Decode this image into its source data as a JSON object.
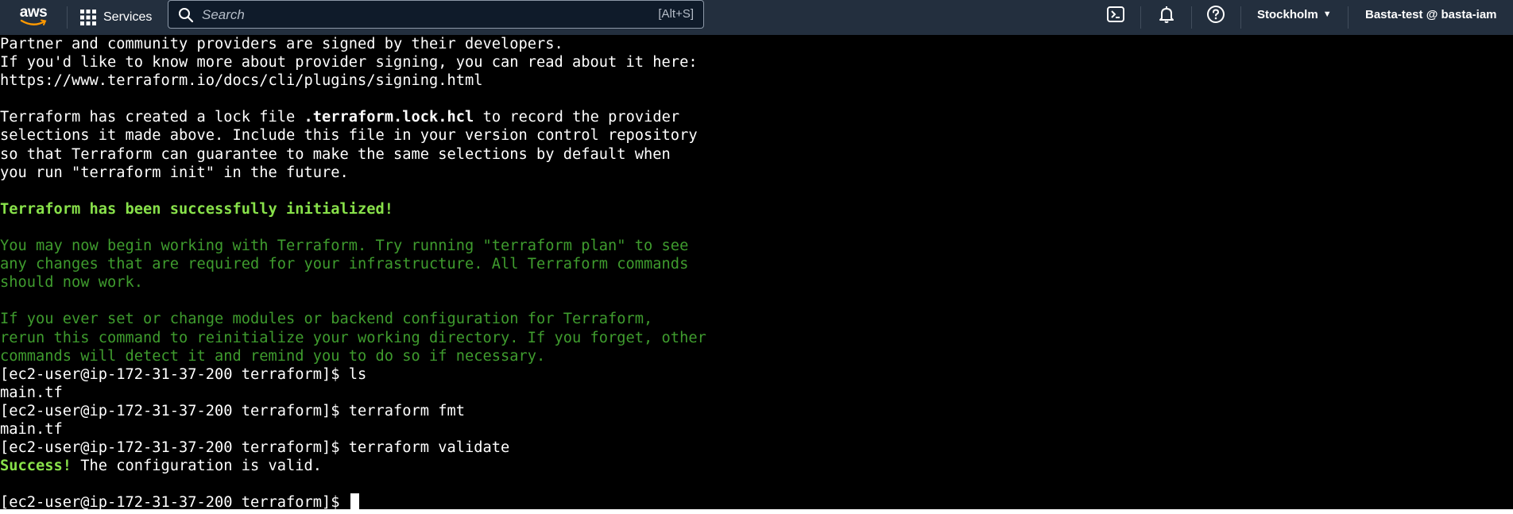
{
  "topbar": {
    "logo_text": "aws",
    "services_label": "Services",
    "search": {
      "placeholder": "Search",
      "shortcut": "[Alt+S]"
    },
    "icons": [
      "cloudshell-icon",
      "bell-icon",
      "help-icon"
    ],
    "region": "Stockholm",
    "account": "Basta-test @ basta-iam",
    "colors": {
      "bar_bg": "#232f3e",
      "smile_orange": "#ff9900"
    }
  },
  "terminal": {
    "lines": [
      {
        "text": "Partner and community providers are signed by their developers."
      },
      {
        "text": "If you'd like to know more about provider signing, you can read about it here:"
      },
      {
        "text": "https://www.terraform.io/docs/cli/plugins/signing.html"
      },
      {
        "text": ""
      },
      {
        "pre": "Terraform has created a lock file ",
        "bold": ".terraform.lock.hcl",
        "post": " to record the provider"
      },
      {
        "text": "selections it made above. Include this file in your version control repository"
      },
      {
        "text": "so that Terraform can guarantee to make the same selections by default when"
      },
      {
        "text": "you run \"terraform init\" in the future."
      },
      {
        "text": ""
      },
      {
        "text": "Terraform has been successfully initialized!",
        "style": "green-bold"
      },
      {
        "text": ""
      },
      {
        "text": "You may now begin working with Terraform. Try running \"terraform plan\" to see",
        "style": "green"
      },
      {
        "text": "any changes that are required for your infrastructure. All Terraform commands",
        "style": "green"
      },
      {
        "text": "should now work.",
        "style": "green"
      },
      {
        "text": ""
      },
      {
        "text": "If you ever set or change modules or backend configuration for Terraform,",
        "style": "green"
      },
      {
        "text": "rerun this command to reinitialize your working directory. If you forget, other",
        "style": "green"
      },
      {
        "text": "commands will detect it and remind you to do so if necessary.",
        "style": "green"
      },
      {
        "text": "[ec2-user@ip-172-31-37-200 terraform]$ ls"
      },
      {
        "text": "main.tf"
      },
      {
        "text": "[ec2-user@ip-172-31-37-200 terraform]$ terraform fmt"
      },
      {
        "text": "main.tf"
      },
      {
        "text": "[ec2-user@ip-172-31-37-200 terraform]$ terraform validate"
      },
      {
        "prefix": "Success!",
        "rest": " The configuration is valid."
      },
      {
        "text": ""
      },
      {
        "text": "[ec2-user@ip-172-31-37-200 terraform]$ ",
        "cursor": true
      }
    ]
  }
}
